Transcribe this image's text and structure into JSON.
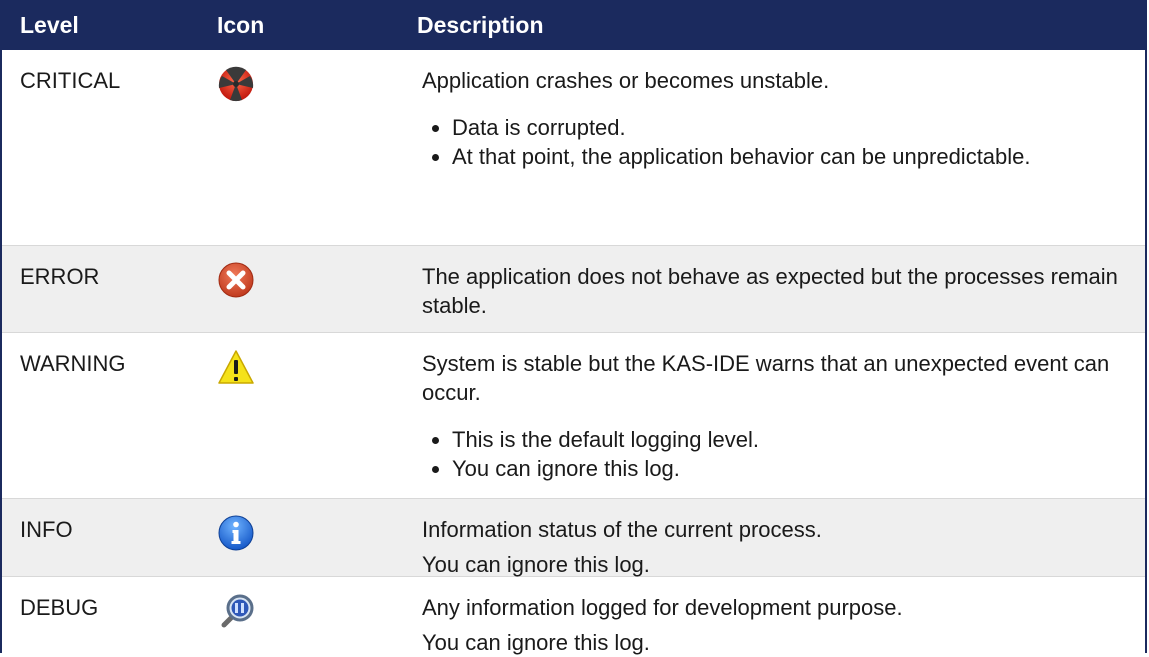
{
  "header": {
    "level": "Level",
    "icon": "Icon",
    "description": "Description"
  },
  "rows": [
    {
      "level": "CRITICAL",
      "icon": "critical-icon",
      "text": "Application crashes or becomes unstable.",
      "bullets": [
        "Data is corrupted.",
        "At that point, the application behavior can be unpredictable."
      ]
    },
    {
      "level": "ERROR",
      "icon": "error-icon",
      "text": "The application does not behave as expected but the processes remain stable."
    },
    {
      "level": "WARNING",
      "icon": "warning-icon",
      "text": "System is stable but the KAS-IDE warns that an unexpected event can occur.",
      "bullets": [
        "This is the default logging level.",
        "You can ignore this log."
      ]
    },
    {
      "level": "INFO",
      "icon": "info-icon",
      "text": "Information status of the current process.",
      "text2": "You can ignore this log."
    },
    {
      "level": "DEBUG",
      "icon": "debug-icon",
      "text": "Any information logged for development purpose.",
      "text2": "You can ignore this log."
    }
  ]
}
